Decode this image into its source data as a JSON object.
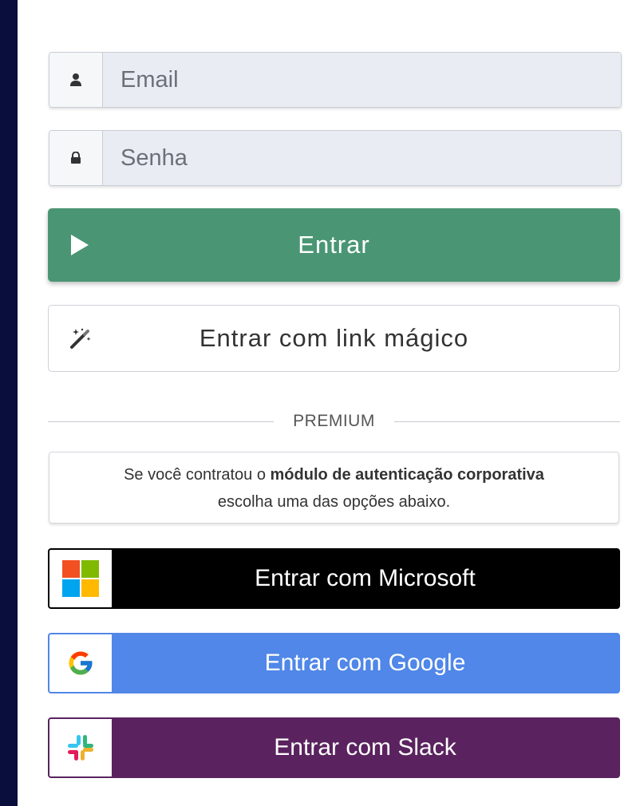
{
  "login": {
    "email_placeholder": "Email",
    "password_placeholder": "Senha",
    "submit_label": "Entrar",
    "magic_link_label": "Entrar com link mágico"
  },
  "premium": {
    "divider_label": "PREMIUM",
    "notice_prefix": "Se você contratou o ",
    "notice_bold": "módulo de autenticação corporativa",
    "notice_suffix": "escolha uma das opções abaixo."
  },
  "sso": {
    "microsoft_label": "Entrar com Microsoft",
    "google_label": "Entrar com Google",
    "slack_label": "Entrar com Slack"
  },
  "colors": {
    "primary": "#4a9674",
    "google": "#5087e8",
    "slack": "#5a235f",
    "microsoft": "#000000",
    "page_background": "#0a0e3d"
  },
  "icons": {
    "email": "user-icon",
    "password": "lock-icon",
    "submit": "play-icon",
    "magic": "magic-wand-icon",
    "microsoft": "microsoft-logo-icon",
    "google": "google-logo-icon",
    "slack": "slack-logo-icon"
  }
}
